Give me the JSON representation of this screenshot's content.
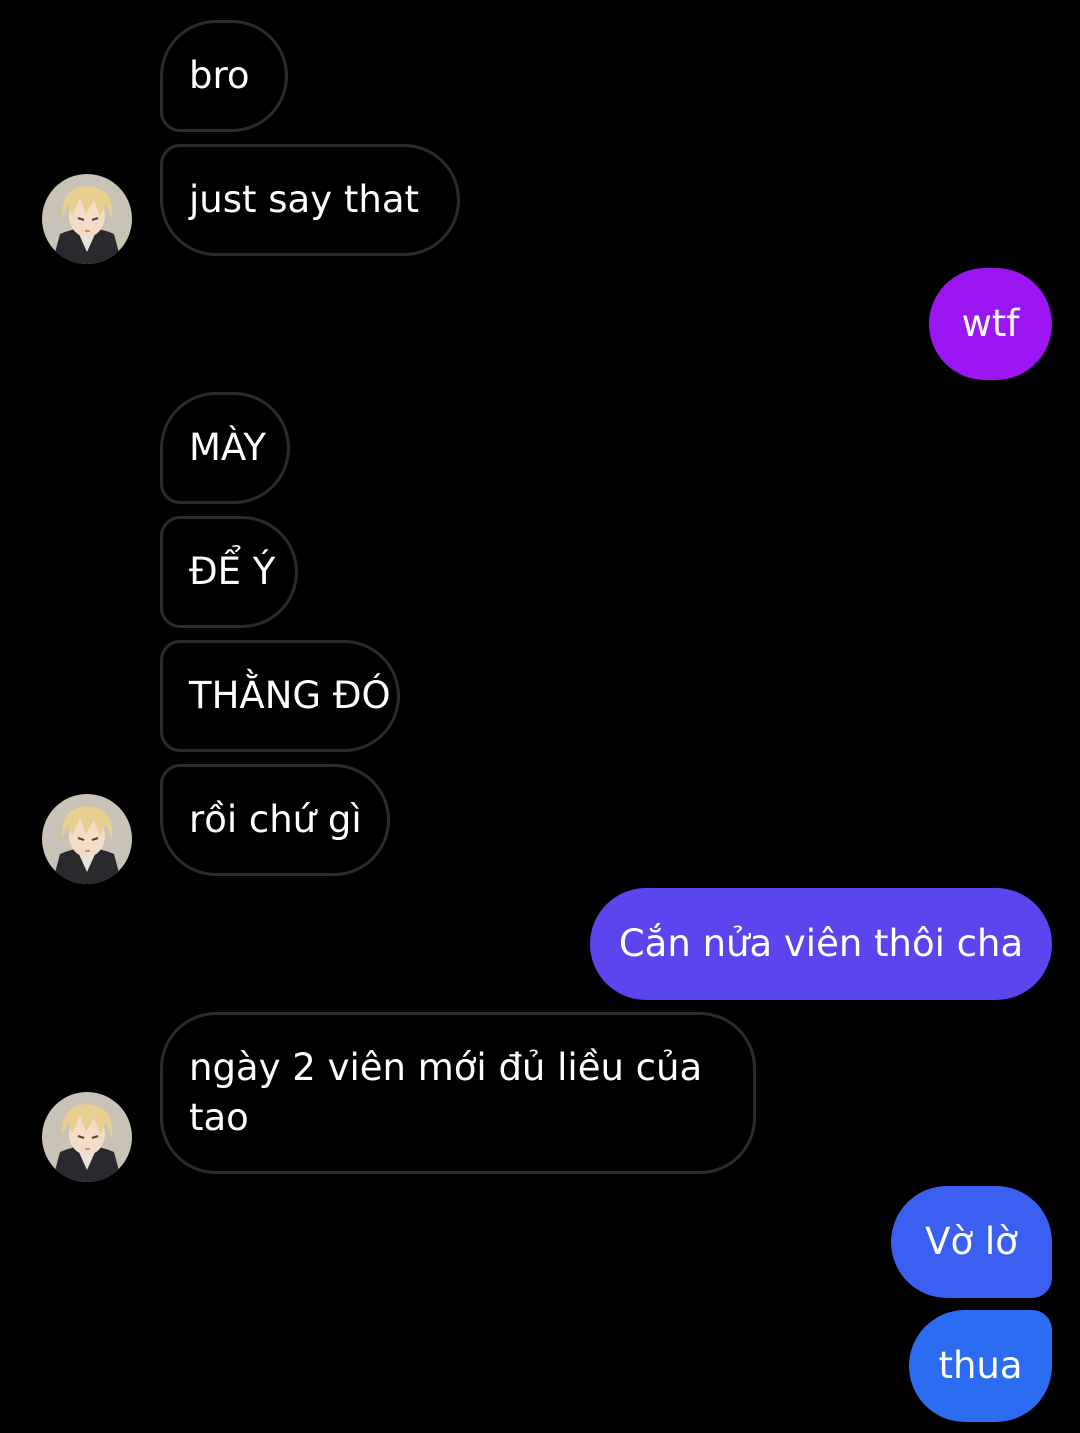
{
  "conversation": {
    "messages": [
      {
        "sender": "other",
        "text": "bro"
      },
      {
        "sender": "other",
        "text": "just say that"
      },
      {
        "sender": "me",
        "text": "wtf"
      },
      {
        "sender": "other",
        "text": "MÀY"
      },
      {
        "sender": "other",
        "text": "ĐỂ Ý"
      },
      {
        "sender": "other",
        "text": "THẰNG ĐÓ"
      },
      {
        "sender": "other",
        "text": "rồi chứ gì"
      },
      {
        "sender": "me",
        "text": "Cắn nửa viên thôi cha"
      },
      {
        "sender": "other",
        "text": "ngày 2 viên mới đủ liều của tao"
      },
      {
        "sender": "me",
        "text": "Vờ lờ"
      },
      {
        "sender": "me",
        "text": "thua"
      }
    ]
  },
  "theme": {
    "background": "#000000",
    "incoming_border": "#2b2b2b",
    "incoming_text": "#ffffff",
    "outgoing_gradient": [
      "#9b16f2",
      "#5a45ee",
      "#3b5ff0",
      "#2c6cf1"
    ]
  },
  "avatar_icon": "contact-avatar-anime-blond"
}
